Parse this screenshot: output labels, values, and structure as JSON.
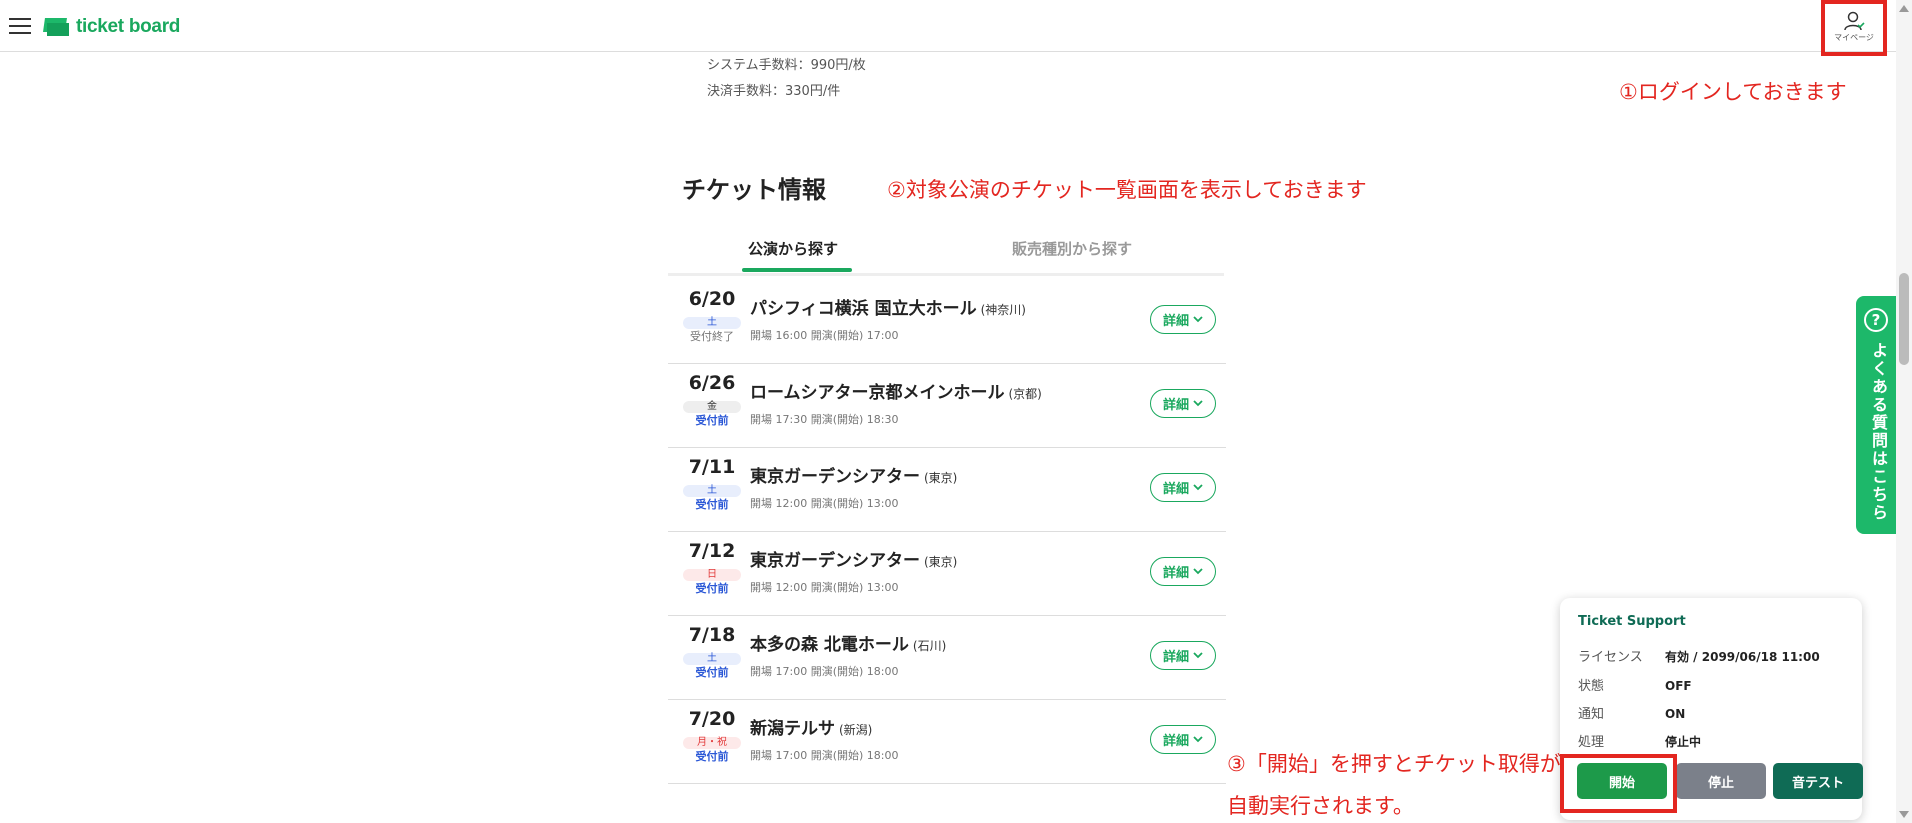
{
  "header": {
    "logo_text": "ticket board",
    "mypage_label": "マイページ"
  },
  "fees": {
    "system_fee": "システム手数料：990円/枚",
    "payment_fee": "決済手数料：330円/件"
  },
  "annotations": {
    "step1": "①ログインしておきます",
    "step2": "②対象公演のチケット一覧画面を表示しておきます",
    "step3_line1": "③「開始」を押すとチケット取得が",
    "step3_line2": "自動実行されます。"
  },
  "ticket_info": {
    "title": "チケット情報",
    "tabs": [
      {
        "label": "公演から探す",
        "active": true
      },
      {
        "label": "販売種別から探す",
        "active": false
      }
    ],
    "detail_label": "詳細",
    "events": [
      {
        "date": "6/20",
        "dow": "土",
        "dow_type": "sat",
        "status": "受付終了",
        "status_type": "closed",
        "venue": "パシフィコ横浜 国立大ホール",
        "pref": "(神奈川)",
        "times": "開場 16:00 開演(開始) 17:00"
      },
      {
        "date": "6/26",
        "dow": "金",
        "dow_type": "wkd",
        "status": "受付前",
        "status_type": "open",
        "venue": "ロームシアター京都メインホール",
        "pref": "(京都)",
        "times": "開場 17:30 開演(開始) 18:30"
      },
      {
        "date": "7/11",
        "dow": "土",
        "dow_type": "sat",
        "status": "受付前",
        "status_type": "open",
        "venue": "東京ガーデンシアター",
        "pref": "(東京)",
        "times": "開場 12:00 開演(開始) 13:00"
      },
      {
        "date": "7/12",
        "dow": "日",
        "dow_type": "sun",
        "status": "受付前",
        "status_type": "open",
        "venue": "東京ガーデンシアター",
        "pref": "(東京)",
        "times": "開場 12:00 開演(開始) 13:00"
      },
      {
        "date": "7/18",
        "dow": "土",
        "dow_type": "sat",
        "status": "受付前",
        "status_type": "open",
        "venue": "本多の森 北電ホール",
        "pref": "(石川)",
        "times": "開場 17:00 開演(開始) 18:00"
      },
      {
        "date": "7/20",
        "dow": "月・祝",
        "dow_type": "sun",
        "status": "受付前",
        "status_type": "open",
        "venue": "新潟テルサ",
        "pref": "(新潟)",
        "times": "開場 17:00 開演(開始) 18:00"
      }
    ]
  },
  "faq": {
    "icon": "?",
    "label": "よくある質問はこちら"
  },
  "ticket_support": {
    "title": "Ticket Support",
    "rows": [
      {
        "label": "ライセンス",
        "value": "有効 / 2099/06/18 11:00"
      },
      {
        "label": "状態",
        "value": "OFF"
      },
      {
        "label": "通知",
        "value": "ON"
      },
      {
        "label": "処理",
        "value": "停止中"
      }
    ],
    "buttons": {
      "start": "開始",
      "stop": "停止",
      "sound_test": "音テスト"
    }
  },
  "colors": {
    "brand_green": "#1aa85e",
    "annotation_red": "#e32620",
    "support_teal": "#0f6b55"
  }
}
